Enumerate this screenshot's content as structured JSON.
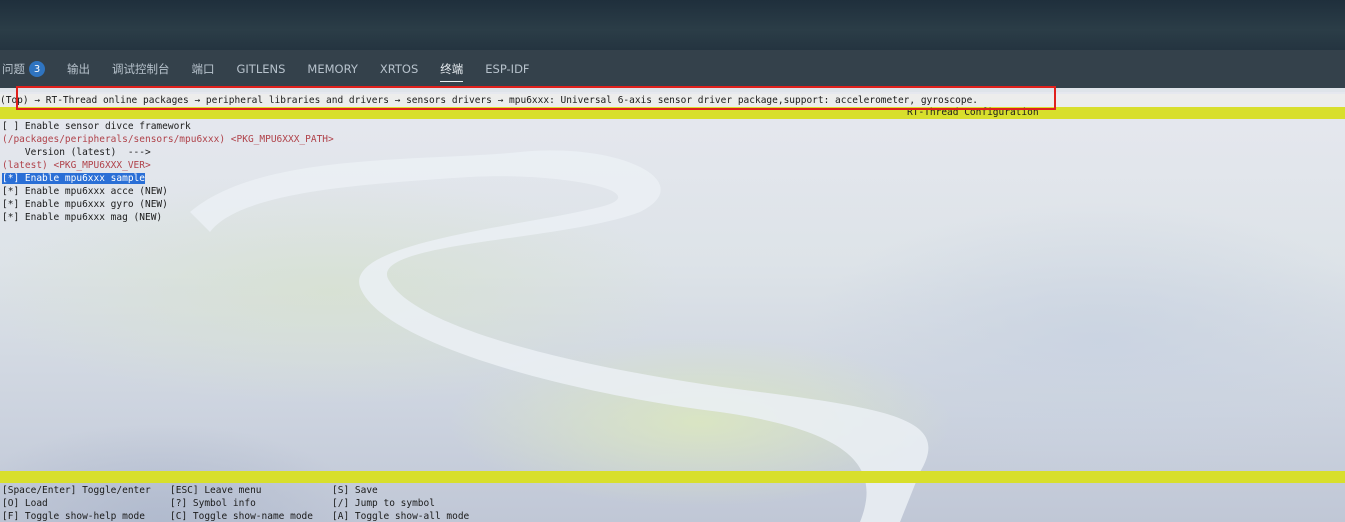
{
  "tabs": [
    {
      "label": "问题",
      "badge": "3"
    },
    {
      "label": "输出"
    },
    {
      "label": "调试控制台"
    },
    {
      "label": "端口"
    },
    {
      "label": "GITLENS"
    },
    {
      "label": "MEMORY"
    },
    {
      "label": "XRTOS"
    },
    {
      "label": "终端",
      "active": true
    },
    {
      "label": "ESP-IDF"
    }
  ],
  "terminal": {
    "path": "(Top) → RT-Thread online packages → peripheral libraries and drivers → sensors drivers → mpu6xxx: Universal 6-axis sensor driver package,support: accelerometer, gyroscope.",
    "config_title": "RT-Thread Configuration",
    "menu": [
      {
        "text": "[ ] Enable sensor divce framework"
      },
      {
        "text": "(/packages/peripherals/sensors/mpu6xxx) <PKG_MPU6XXX_PATH>",
        "style": "red"
      },
      {
        "text": "    Version (latest)  --->"
      },
      {
        "text": "(latest) <PKG_MPU6XXX_VER>",
        "style": "red"
      },
      {
        "text": "[*] Enable mpu6xxx sample",
        "selected": true
      },
      {
        "text": "[*] Enable mpu6xxx acce (NEW)"
      },
      {
        "text": "[*] Enable mpu6xxx gyro (NEW)"
      },
      {
        "text": "[*] Enable mpu6xxx mag (NEW)"
      }
    ],
    "help": [
      [
        "[Space/Enter] Toggle/enter",
        "[ESC] Leave menu",
        "[S] Save"
      ],
      [
        "[O] Load",
        "[?] Symbol info",
        "[/] Jump to symbol"
      ],
      [
        "[F] Toggle show-help mode",
        "[C] Toggle show-name mode",
        "[A] Toggle show-all mode"
      ]
    ]
  },
  "colors": {
    "highlight_box": "#e0201c",
    "status_bar": "#d8df2c",
    "selection": "#2a6fd6",
    "badge": "#2f74c0"
  }
}
